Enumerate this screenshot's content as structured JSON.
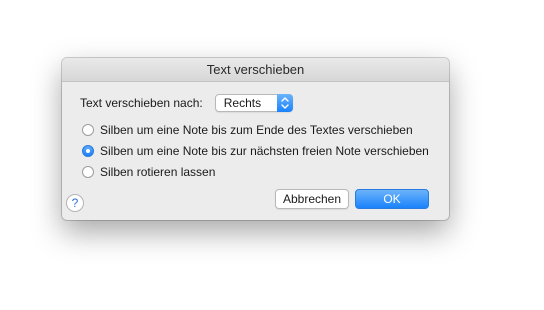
{
  "dialog": {
    "title": "Text verschieben",
    "target_label": "Text verschieben nach:",
    "target_value": "Rechts",
    "options": [
      {
        "label": "Silben um eine Note bis zum Ende des Textes verschieben",
        "checked": false
      },
      {
        "label": "Silben um eine Note bis zur nächsten freien Note verschieben",
        "checked": true
      },
      {
        "label": "Silben rotieren lassen",
        "checked": false
      }
    ],
    "help_label": "?",
    "cancel_label": "Abbrechen",
    "ok_label": "OK"
  },
  "colors": {
    "accent": "#1b82fb",
    "window_background": "#ececec"
  }
}
